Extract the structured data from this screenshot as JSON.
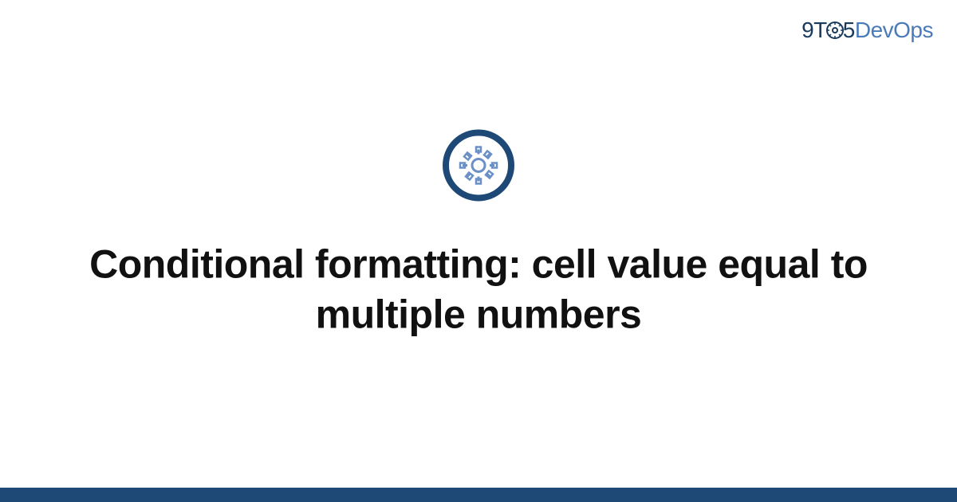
{
  "logo": {
    "part1": "9T",
    "part2": "5",
    "part3": "DevOps"
  },
  "title": "Conditional formatting: cell value equal to multiple numbers",
  "colors": {
    "dark_blue": "#1e4976",
    "light_blue": "#6b8fc7",
    "text": "#111111"
  }
}
